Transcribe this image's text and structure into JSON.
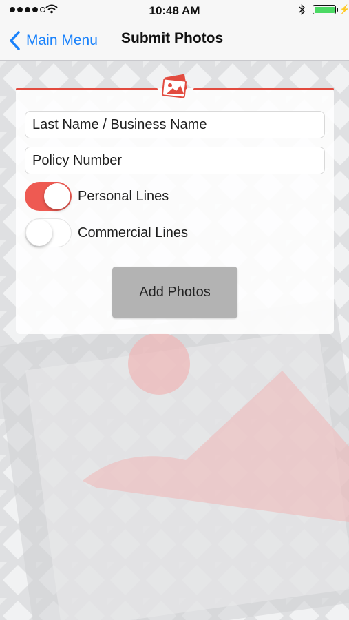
{
  "status_bar": {
    "time": "10:48 AM",
    "signal_icon": "cellular-signal-icon",
    "wifi_icon": "wifi-icon",
    "bluetooth_icon": "bluetooth-icon",
    "battery_icon": "battery-charging-icon",
    "battery_color": "#4cd964"
  },
  "nav": {
    "back_label": "Main Menu",
    "title": "Submit Photos",
    "accent_color": "#1a82fb"
  },
  "form": {
    "header_icon": "photos-icon",
    "accent_color": "#e24b3f",
    "last_name_placeholder": "Last Name / Business Name",
    "last_name_value": "",
    "policy_placeholder": "Policy Number",
    "policy_value": "",
    "toggles": [
      {
        "label": "Personal Lines",
        "on": true
      },
      {
        "label": "Commercial Lines",
        "on": false
      }
    ],
    "add_photos_label": "Add Photos"
  }
}
